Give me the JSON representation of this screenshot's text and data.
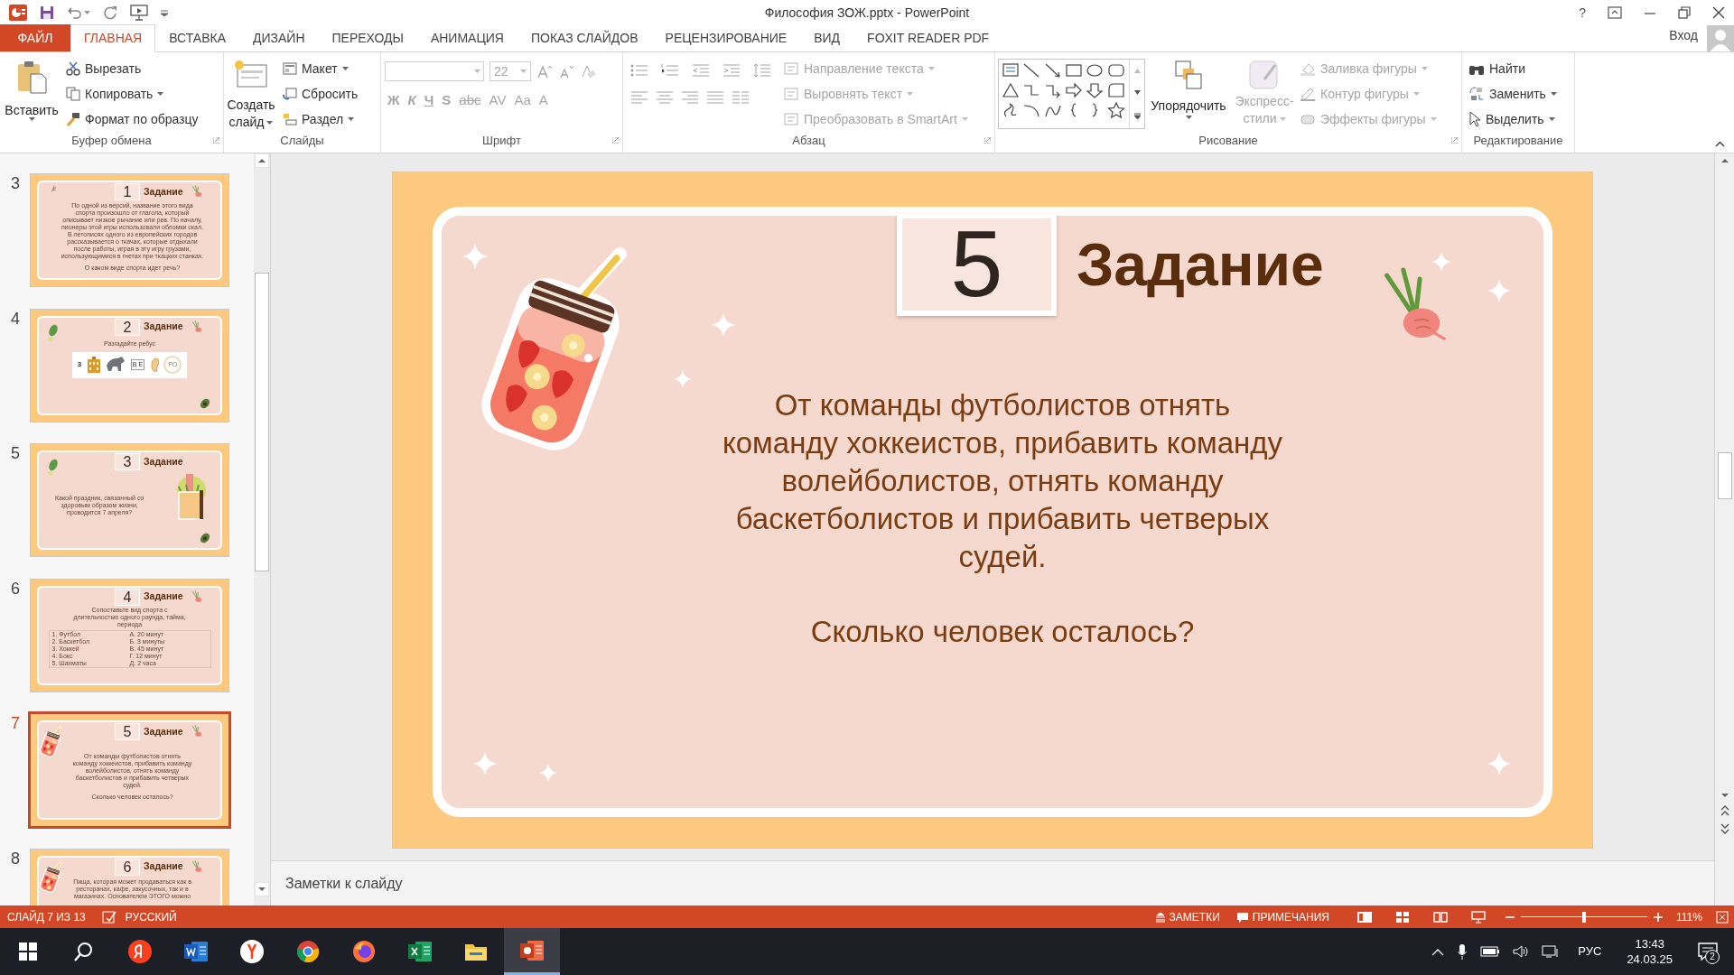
{
  "window": {
    "title": "Философия ЗОЖ.pptx - PowerPoint",
    "help": "?"
  },
  "ribbon_tabs": [
    {
      "label": "ФАЙЛ",
      "kind": "file",
      "selected": false
    },
    {
      "label": "ГЛАВНАЯ",
      "kind": "tab",
      "selected": true
    },
    {
      "label": "ВСТАВКА",
      "kind": "tab",
      "selected": false
    },
    {
      "label": "ДИЗАЙН",
      "kind": "tab",
      "selected": false
    },
    {
      "label": "ПЕРЕХОДЫ",
      "kind": "tab",
      "selected": false
    },
    {
      "label": "АНИМАЦИЯ",
      "kind": "tab",
      "selected": false
    },
    {
      "label": "ПОКАЗ СЛАЙДОВ",
      "kind": "tab",
      "selected": false
    },
    {
      "label": "РЕЦЕНЗИРОВАНИЕ",
      "kind": "tab",
      "selected": false
    },
    {
      "label": "ВИД",
      "kind": "tab",
      "selected": false
    },
    {
      "label": "FOXIT READER PDF",
      "kind": "tab",
      "selected": false
    }
  ],
  "account": {
    "label": "Вход"
  },
  "clipboard": {
    "label": "Буфер обмена",
    "paste": "Вставить",
    "cut": "Вырезать",
    "copy": "Копировать",
    "format_painter": "Формат по образцу"
  },
  "slides_group": {
    "label": "Слайды",
    "new_slide": [
      "Создать",
      "слайд"
    ],
    "layout": "Макет",
    "reset": "Сбросить",
    "section": "Раздел"
  },
  "font": {
    "label": "Шрифт",
    "size": "22",
    "disabled": true,
    "buttons": [
      "Ж",
      "К",
      "Ч",
      "S",
      "abc",
      "AV",
      "Aa",
      "A"
    ]
  },
  "paragraph": {
    "label": "Абзац",
    "commands": [
      {
        "label": "Направление текста",
        "disabled": true
      },
      {
        "label": "Выровнять текст",
        "disabled": true
      },
      {
        "label": "Преобразовать в SmartArt",
        "disabled": true
      }
    ]
  },
  "drawing": {
    "label": "Рисование",
    "arrange": "Упорядочить",
    "quick_styles": {
      "lines": [
        "Экспресс-",
        "стили"
      ],
      "disabled": true
    },
    "commands": [
      {
        "label": "Заливка фигуры",
        "disabled": true
      },
      {
        "label": "Контур фигуры",
        "disabled": true
      },
      {
        "label": "Эффекты фигуры",
        "disabled": true
      }
    ]
  },
  "editing": {
    "label": "Редактирование",
    "commands": [
      {
        "label": "Найти",
        "kind": "find"
      },
      {
        "label": "Заменить",
        "kind": "replace"
      },
      {
        "label": "Выделить",
        "kind": "select"
      }
    ]
  },
  "thumbnails": [
    {
      "number": "3",
      "selected": false,
      "task": "1",
      "title": "Задание",
      "kind": "text",
      "decor": [
        {
          "kind": "sprig"
        },
        {
          "kind": "radish"
        }
      ],
      "lines": [
        "По одной из версий, название этого вида",
        "спорта произошло от глагола, который",
        "описывает низкое рычание или рев. По началу,",
        "пионеры этой игры использовали обломки скал.",
        "В летописях одного из европейских городов",
        "рассказывается о ткачах, которые отдыхали",
        "после работы, играя в эту игру грузами,",
        "использующимися в гнетах при ткацких станках."
      ],
      "question": "О каком виде спорта идет речь?"
    },
    {
      "number": "4",
      "selected": false,
      "task": "2",
      "title": "Задание",
      "kind": "rebus",
      "decor": [
        {
          "kind": "leaf"
        },
        {
          "kind": "radish"
        },
        {
          "kind": "avocado"
        }
      ],
      "lines": [
        "Разгадайте ребус"
      ],
      "rebus": [
        {
          "kind": "text",
          "text": "3"
        },
        {
          "kind": "building"
        },
        {
          "kind": "animal"
        },
        {
          "kind": "letters",
          "text": "В Е"
        },
        {
          "kind": "ear"
        },
        {
          "kind": "ring",
          "text": "РО"
        }
      ]
    },
    {
      "number": "5",
      "selected": false,
      "task": "3",
      "title": "Задание",
      "kind": "illustrated",
      "decor": [
        {
          "kind": "leaf"
        },
        {
          "kind": "avocado"
        }
      ],
      "lines": [
        "Какой праздник, связанный со",
        "здоровым образом жизни,",
        "проводится 7 апреля?"
      ]
    },
    {
      "number": "6",
      "selected": false,
      "task": "4",
      "title": "Задание",
      "kind": "matching",
      "decor": [
        {
          "kind": "radish"
        }
      ],
      "lines": [
        "Сопоставьте вид спорта с",
        "длительностью одного раунда, тайма,",
        "периода"
      ],
      "rows": [
        [
          "1.  Футбол",
          "А. 20 минут"
        ],
        [
          "2.  Баскетбол",
          "Б. 3 минуты"
        ],
        [
          "3.  Хоккей",
          "В. 45 минут"
        ],
        [
          "4.  Бокс",
          "Г. 12 минут"
        ],
        [
          "5.  Шахматы",
          "Д. 2 часа"
        ]
      ]
    },
    {
      "number": "7",
      "selected": true,
      "task": "5",
      "title": "Задание",
      "kind": "text",
      "decor": [
        {
          "kind": "jar"
        },
        {
          "kind": "radish"
        }
      ],
      "lines": [
        "От команды футболистов отнять",
        "команду хоккеистов, прибавить команду",
        "волейболистов, отнять команду",
        "баскетболистов и прибавить четверых",
        "судей."
      ],
      "question": "Сколько человек осталось?"
    },
    {
      "number": "8",
      "selected": false,
      "task": "6",
      "title": "Задание",
      "kind": "text",
      "decor": [
        {
          "kind": "jar"
        },
        {
          "kind": "radish"
        }
      ],
      "lines": [
        "Пища, которая может продаваться как в",
        "ресторанах, кафе, закусочных, так и в",
        "магазинах. Основателем ЭТОГО можно"
      ]
    }
  ],
  "slide": {
    "number": "5",
    "title": "Задание",
    "body_lines": [
      "От команды футболистов отнять",
      "команду хоккеистов, прибавить команду",
      "волейболистов, отнять команду",
      "баскетболистов и прибавить четверых",
      "судей."
    ],
    "question": "Сколько человек осталось?"
  },
  "notes": {
    "placeholder": "Заметки к слайду"
  },
  "status_bar": {
    "slide_info": "СЛАЙД 7 ИЗ 13",
    "language": "РУССКИЙ",
    "notes": "ЗАМЕТКИ",
    "comments": "ПРИМЕЧАНИЯ",
    "zoom": {
      "level": 0.5,
      "reading": "111%"
    }
  },
  "taskbar": {
    "apps": [
      {
        "kind": "start",
        "selected": false
      },
      {
        "kind": "search",
        "selected": false
      },
      {
        "kind": "yandex",
        "selected": false
      },
      {
        "kind": "word",
        "selected": false
      },
      {
        "kind": "yandex-browser",
        "selected": false
      },
      {
        "kind": "chrome",
        "selected": false
      },
      {
        "kind": "firefox",
        "selected": false
      },
      {
        "kind": "excel",
        "selected": false
      },
      {
        "kind": "explorer",
        "selected": false
      },
      {
        "kind": "powerpoint",
        "selected": true
      }
    ],
    "language": "РУС",
    "time": "13:43",
    "date": "24.03.25",
    "notifications": "2"
  }
}
